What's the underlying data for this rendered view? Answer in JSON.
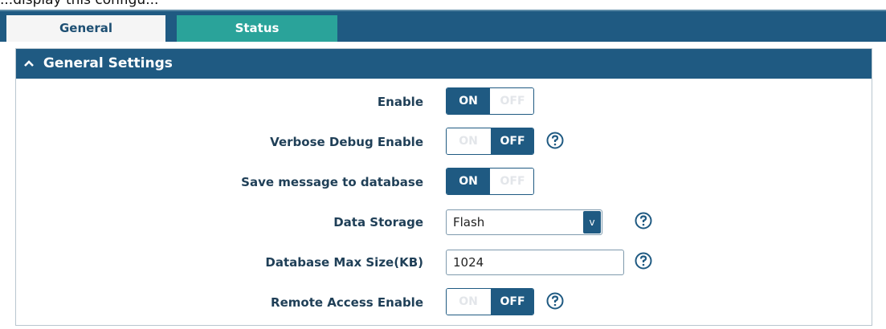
{
  "top_cropped_text": "...display this configu...",
  "tabs": [
    {
      "label": "General"
    },
    {
      "label": "Status"
    }
  ],
  "panel": {
    "title": "General Settings",
    "caret": "^"
  },
  "fields": {
    "enable": {
      "label": "Enable",
      "value": "ON",
      "on_text": "ON",
      "off_text": "OFF"
    },
    "verbose_debug": {
      "label": "Verbose Debug Enable",
      "value": "OFF",
      "on_text": "ON",
      "off_text": "OFF"
    },
    "save_to_db": {
      "label": "Save message to database",
      "value": "ON",
      "on_text": "ON",
      "off_text": "OFF"
    },
    "data_storage": {
      "label": "Data Storage",
      "value": "Flash",
      "arrow": "v"
    },
    "db_max_size": {
      "label": "Database Max Size(KB)",
      "value": "1024"
    },
    "remote_access": {
      "label": "Remote Access Enable",
      "value": "OFF",
      "on_text": "ON",
      "off_text": "OFF"
    }
  },
  "colors": {
    "primary": "#1f5a82",
    "tab_status": "#2aa39a",
    "tab_active_bg": "#f5f5f5"
  },
  "icons": {
    "help": "help-circle-icon",
    "caret": "chevron-up-icon",
    "dropdown": "chevron-down-icon"
  }
}
